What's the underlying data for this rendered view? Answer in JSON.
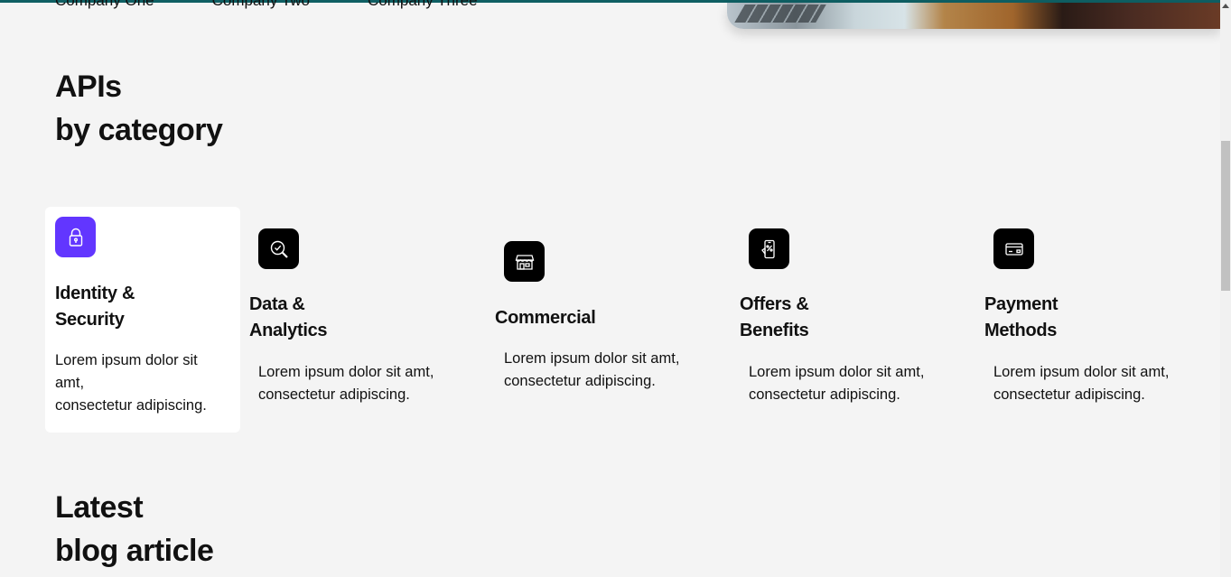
{
  "companies": [
    "Company One",
    "Company Two",
    "Company Three"
  ],
  "apis_title": {
    "line1": "APIs",
    "line2": "by category"
  },
  "categories": [
    {
      "title1": "Identity &",
      "title2": "Security",
      "desc1": "Lorem ipsum dolor sit",
      "desc2": "amt,",
      "desc3": "consectetur adipiscing.",
      "icon": "lock-icon"
    },
    {
      "title1": "Data &",
      "title2": "Analytics",
      "desc1": "Lorem ipsum dolor sit amt,",
      "desc2": "consectetur adipiscing.",
      "icon": "magnifier-check-icon"
    },
    {
      "title1": "Commercial",
      "desc1": "Lorem ipsum dolor sit amt,",
      "desc2": "consectetur adipiscing.",
      "icon": "storefront-icon"
    },
    {
      "title1": "Offers &",
      "title2": "Benefits",
      "desc1": "Lorem ipsum dolor sit amt,",
      "desc2": "consectetur adipiscing.",
      "icon": "phone-offer-icon"
    },
    {
      "title1": "Payment",
      "title2": "Methods",
      "desc1": "Lorem ipsum dolor sit amt,",
      "desc2": "consectetur adipiscing.",
      "icon": "credit-card-icon"
    }
  ],
  "blog_title": {
    "line1": "Latest",
    "line2": "blog article"
  },
  "colors": {
    "accent": "#6236ff",
    "icon_bg": "#000000",
    "page_bg": "#f4f4f4",
    "topbar": "#0f5f63"
  }
}
